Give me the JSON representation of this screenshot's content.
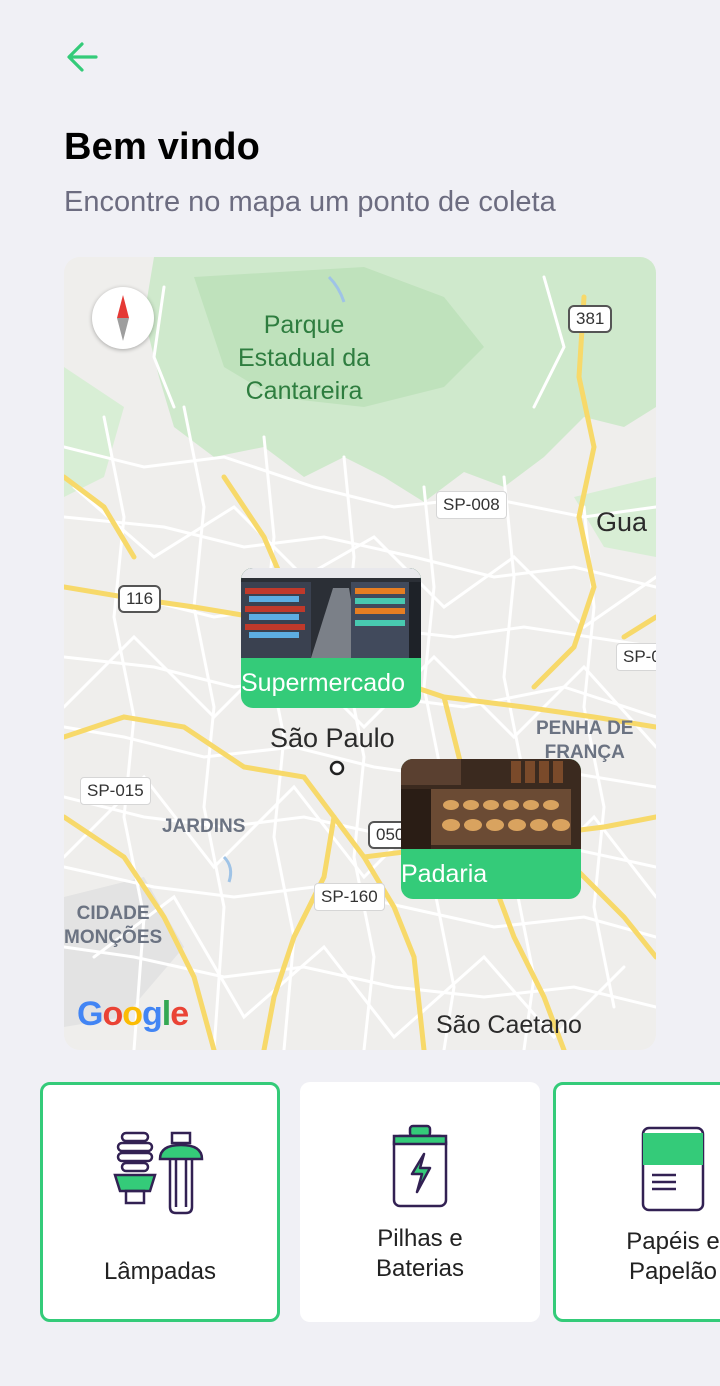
{
  "header": {
    "back_icon": "arrow-left-icon"
  },
  "welcome": {
    "title": "Bem vindo",
    "subtitle": "Encontre no mapa um ponto de coleta"
  },
  "map": {
    "labels": {
      "park": "Parque\nEstadual da\nCantareira",
      "sp008": "SP-008",
      "r381": "381",
      "r116": "116",
      "gua": "Gua",
      "spc": "SP-0",
      "sao_paulo": "São Paulo",
      "penha": "PENHA DE\nFRANÇA",
      "sp015": "SP-015",
      "jardins": "JARDINS",
      "r050": "050",
      "sp160": "SP-160",
      "cidade_moncoes": "CIDADE\nMONÇÕES",
      "sao_caetano": "São Caetano"
    },
    "google_logo": "Google",
    "markers": [
      {
        "label": "Supermercado",
        "icon": "supermarket-photo"
      },
      {
        "label": "Padaria",
        "icon": "bakery-photo"
      }
    ],
    "colors": {
      "accent": "#34cb79",
      "park": "#cdeacc",
      "road": "#f6d96b"
    }
  },
  "items": [
    {
      "label": "Lâmpadas",
      "icon": "lamps-icon",
      "selected": true
    },
    {
      "label": "Pilhas e\nBaterias",
      "icon": "battery-icon",
      "selected": false
    },
    {
      "label": "Papéis e\nPapelão",
      "icon": "paper-icon",
      "selected": true
    }
  ]
}
